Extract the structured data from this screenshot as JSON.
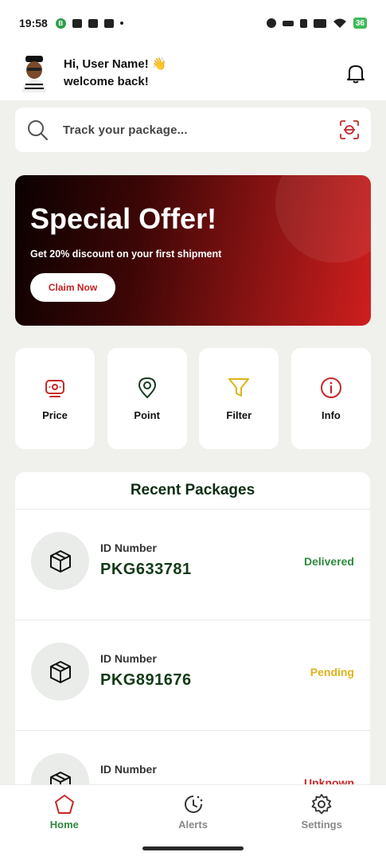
{
  "status_bar": {
    "time": "19:58",
    "battery": "36",
    "icons": [
      "b-badge-icon",
      "chat-icon",
      "message-icon",
      "group-icon",
      "dot-icon",
      "sync-icon",
      "link-icon",
      "vibrate-icon",
      "signal-icon",
      "wifi-icon",
      "battery-icon"
    ]
  },
  "header": {
    "greeting": "Hi, User Name! 👋",
    "subtext": "welcome back!"
  },
  "search": {
    "placeholder": "Track your package..."
  },
  "offer": {
    "title": "Special Offer!",
    "subtitle": "Get 20% discount on your first shipment",
    "button": "Claim Now"
  },
  "actions": [
    {
      "label": "Price",
      "icon": "price-icon",
      "color": "#c62828"
    },
    {
      "label": "Point",
      "icon": "location-pin-icon",
      "color": "#1a3a1f"
    },
    {
      "label": "Filter",
      "icon": "filter-icon",
      "color": "#e0b21a"
    },
    {
      "label": "Info",
      "icon": "info-icon",
      "color": "#c62828"
    }
  ],
  "recent": {
    "title": "Recent Packages",
    "items": [
      {
        "id_label": "ID Number",
        "id": "PKG633781",
        "status": "Delivered",
        "status_color": "#2e8b3e"
      },
      {
        "id_label": "ID Number",
        "id": "PKG891676",
        "status": "Pending",
        "status_color": "#e0b21a"
      },
      {
        "id_label": "ID Number",
        "id": "",
        "status": "Unknown",
        "status_color": "#c62828"
      }
    ]
  },
  "nav": [
    {
      "label": "Home",
      "icon": "home-icon",
      "active": true,
      "color": "#2e8b3e"
    },
    {
      "label": "Alerts",
      "icon": "clock-icon",
      "active": false,
      "color": "#888888"
    },
    {
      "label": "Settings",
      "icon": "gear-icon",
      "active": false,
      "color": "#888888"
    }
  ],
  "colors": {
    "accent_red": "#c62828",
    "accent_green": "#2e8b3e",
    "background": "#f0f0ec"
  }
}
